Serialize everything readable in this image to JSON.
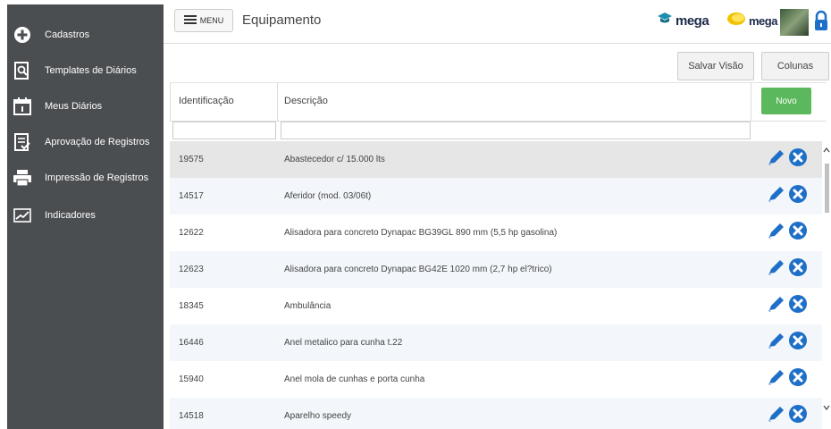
{
  "sidebar": {
    "items": [
      {
        "label": "Cadastros",
        "icon": "plus-circle-icon"
      },
      {
        "label": "Templates de Diários",
        "icon": "document-search-icon"
      },
      {
        "label": "Meus Diários",
        "icon": "calendar-icon"
      },
      {
        "label": "Aprovação de Registros",
        "icon": "checklist-icon"
      },
      {
        "label": "Impressão de Registros",
        "icon": "printer-icon"
      },
      {
        "label": "Indicadores",
        "icon": "chart-icon"
      }
    ]
  },
  "header": {
    "menu_label": "MENU",
    "title": "Equipamento",
    "logo1_text": "mega",
    "logo2_text": "mega"
  },
  "toolbar": {
    "save_view_label": "Salvar Visão",
    "columns_label": "Colunas"
  },
  "table": {
    "columns": [
      "Identificação",
      "Descrição"
    ],
    "new_label": "Novo",
    "rows": [
      {
        "id": "19575",
        "desc": "Abastecedor c/ 15.000 lts"
      },
      {
        "id": "14517",
        "desc": "Aferidor (mod. 03/06t)"
      },
      {
        "id": "12622",
        "desc": "Alisadora para concreto Dynapac BG39GL 890 mm (5,5 hp gasolina)"
      },
      {
        "id": "12623",
        "desc": "Alisadora para concreto Dynapac BG42E 1020 mm (2,7 hp el?trico)"
      },
      {
        "id": "18345",
        "desc": "Ambulância"
      },
      {
        "id": "16446",
        "desc": "Anel metalico para cunha t.22"
      },
      {
        "id": "15940",
        "desc": "Anel mola de cunhas e porta cunha"
      },
      {
        "id": "14518",
        "desc": "Aparelho speedy"
      }
    ]
  },
  "colors": {
    "sidebar_bg": "#4b4e51",
    "row_selected": "#e6e6e6",
    "row_alt": "#f3f7fb",
    "accent_blue": "#1e6fc7",
    "new_button": "#5cb85c"
  }
}
